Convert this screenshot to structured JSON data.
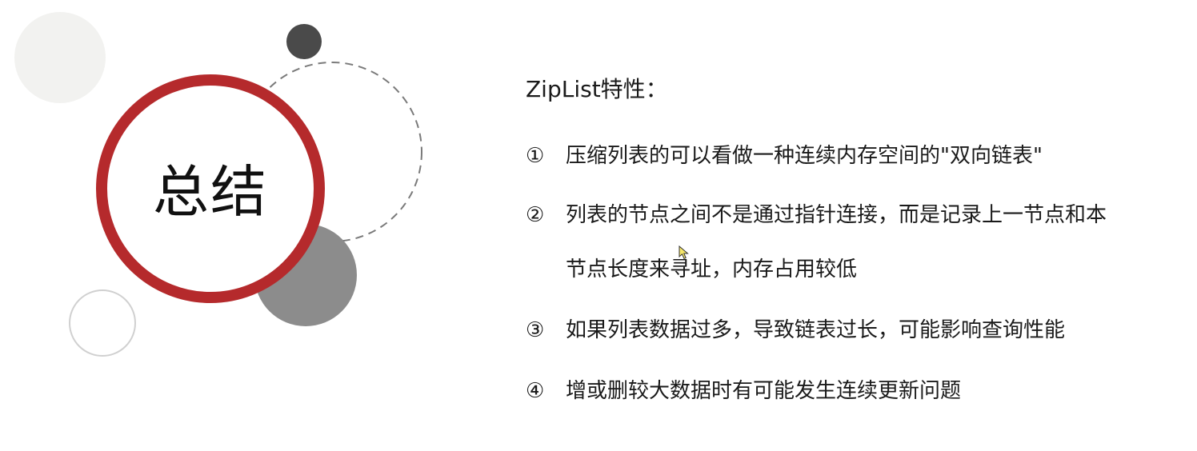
{
  "summary": {
    "title": "总结"
  },
  "content": {
    "heading": "ZipList特性：",
    "points": [
      {
        "num": "①",
        "text": "压缩列表的可以看做一种连续内存空间的\"双向链表\""
      },
      {
        "num": "②",
        "text": "列表的节点之间不是通过指针连接，而是记录上一节点和本",
        "continuation": "节点长度来寻址，内存占用较低"
      },
      {
        "num": "③",
        "text": "如果列表数据过多，导致链表过长，可能影响查询性能"
      },
      {
        "num": "④",
        "text": "增或删较大数据时有可能发生连续更新问题"
      }
    ]
  },
  "colors": {
    "ring": "#b52a2c",
    "dark_dot": "#4a4a4a",
    "gray_circle": "#8c8c8c",
    "light_circle": "#f2f2f0",
    "outline_circle": "#d0d0d0",
    "dashed_circle": "#7a7a7a"
  }
}
